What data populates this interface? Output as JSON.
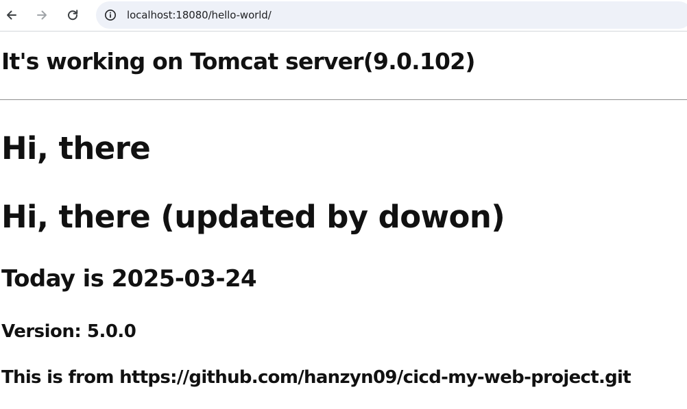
{
  "browser": {
    "address_bar": {
      "url": "localhost:18080/hello-world/"
    },
    "icons": {
      "back": "back-arrow-icon",
      "forward": "forward-arrow-icon",
      "reload": "reload-icon",
      "site_info": "info-icon"
    },
    "colors": {
      "omnibox_bg": "#eef1f8",
      "icon_active": "#3c4043",
      "icon_disabled": "#a0a4a8"
    }
  },
  "page": {
    "server_heading": "It's working on Tomcat server(9.0.102)",
    "greeting": "Hi, there",
    "greeting_updated": "Hi, there (updated by dowon)",
    "today": "Today is 2025-03-24",
    "version": "Version: 5.0.0",
    "source": "This is from https://github.com/hanzyn09/cicd-my-web-project.git"
  }
}
